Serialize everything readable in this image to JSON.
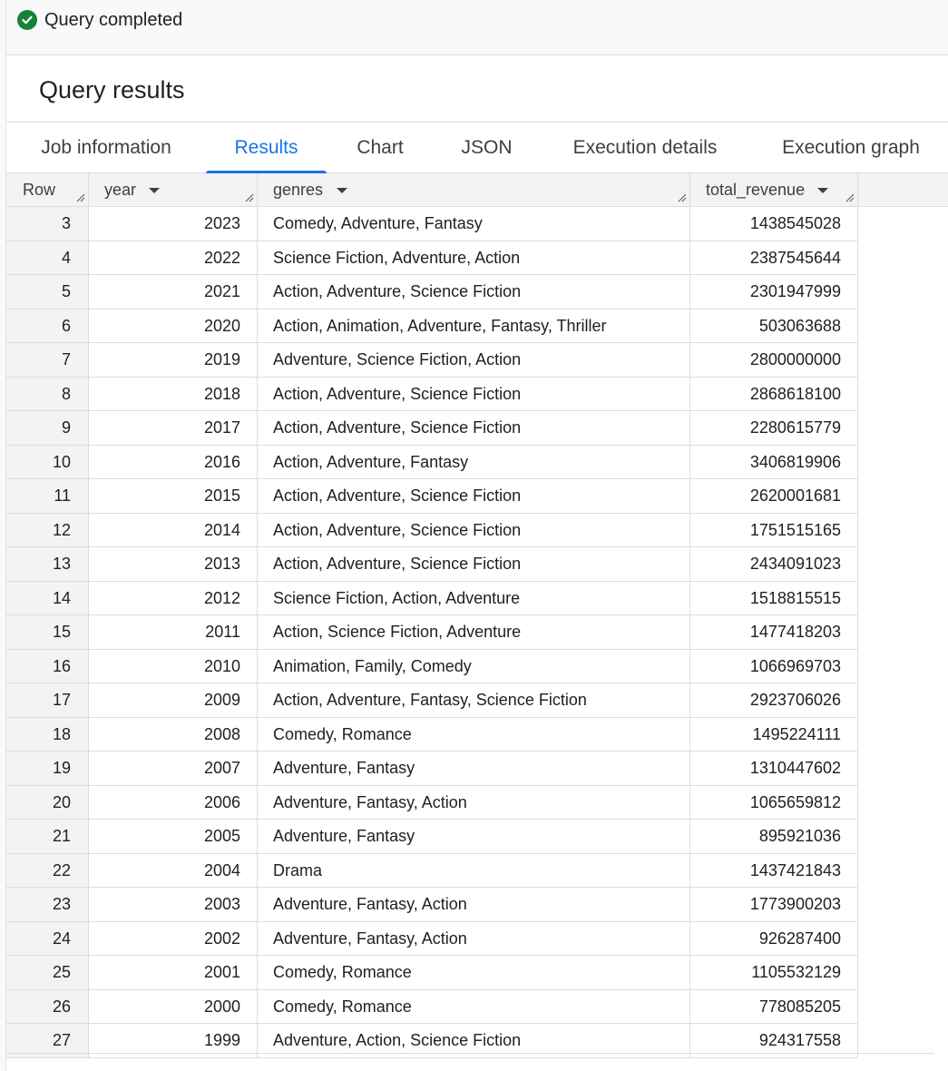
{
  "status": {
    "text": "Query completed",
    "icon": "check-circle-icon",
    "color": "#188038"
  },
  "title": "Query results",
  "tabs": [
    {
      "label": "Job information",
      "active": false
    },
    {
      "label": "Results",
      "active": true
    },
    {
      "label": "Chart",
      "active": false
    },
    {
      "label": "JSON",
      "active": false
    },
    {
      "label": "Execution details",
      "active": false
    },
    {
      "label": "Execution graph",
      "active": false
    }
  ],
  "table": {
    "columns": [
      "Row",
      "year",
      "genres",
      "total_revenue"
    ],
    "rows": [
      [
        "3",
        "2023",
        "Comedy, Adventure, Fantasy",
        "1438545028"
      ],
      [
        "4",
        "2022",
        "Science Fiction, Adventure, Action",
        "2387545644"
      ],
      [
        "5",
        "2021",
        "Action, Adventure, Science Fiction",
        "2301947999"
      ],
      [
        "6",
        "2020",
        "Action, Animation, Adventure, Fantasy, Thriller",
        "503063688"
      ],
      [
        "7",
        "2019",
        "Adventure, Science Fiction, Action",
        "2800000000"
      ],
      [
        "8",
        "2018",
        "Action, Adventure, Science Fiction",
        "2868618100"
      ],
      [
        "9",
        "2017",
        "Action, Adventure, Science Fiction",
        "2280615779"
      ],
      [
        "10",
        "2016",
        "Action, Adventure, Fantasy",
        "3406819906"
      ],
      [
        "11",
        "2015",
        "Action, Adventure, Science Fiction",
        "2620001681"
      ],
      [
        "12",
        "2014",
        "Action, Adventure, Science Fiction",
        "1751515165"
      ],
      [
        "13",
        "2013",
        "Action, Adventure, Science Fiction",
        "2434091023"
      ],
      [
        "14",
        "2012",
        "Science Fiction, Action, Adventure",
        "1518815515"
      ],
      [
        "15",
        "2011",
        "Action, Science Fiction, Adventure",
        "1477418203"
      ],
      [
        "16",
        "2010",
        "Animation, Family, Comedy",
        "1066969703"
      ],
      [
        "17",
        "2009",
        "Action, Adventure, Fantasy, Science Fiction",
        "2923706026"
      ],
      [
        "18",
        "2008",
        "Comedy, Romance",
        "1495224111"
      ],
      [
        "19",
        "2007",
        "Adventure, Fantasy",
        "1310447602"
      ],
      [
        "20",
        "2006",
        "Adventure, Fantasy, Action",
        "1065659812"
      ],
      [
        "21",
        "2005",
        "Adventure, Fantasy",
        "895921036"
      ],
      [
        "22",
        "2004",
        "Drama",
        "1437421843"
      ],
      [
        "23",
        "2003",
        "Adventure, Fantasy, Action",
        "1773900203"
      ],
      [
        "24",
        "2002",
        "Adventure, Fantasy, Action",
        "926287400"
      ],
      [
        "25",
        "2001",
        "Comedy, Romance",
        "1105532129"
      ],
      [
        "26",
        "2000",
        "Comedy, Romance",
        "778085205"
      ],
      [
        "27",
        "1999",
        "Adventure, Action, Science Fiction",
        "924317558"
      ]
    ]
  },
  "colors": {
    "accent": "#1a73e8",
    "success": "#188038"
  }
}
